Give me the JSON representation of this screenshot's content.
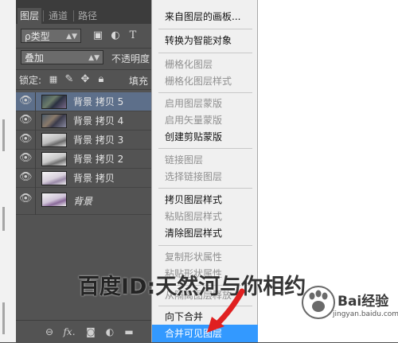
{
  "panel": {
    "tabs": [
      "图层",
      "通道",
      "路径"
    ],
    "filter_kind": "ρ类型",
    "blend_mode": "叠加",
    "opacity_label": "不透明度",
    "lock_label": "锁定:",
    "fill_label": "填充",
    "layers": [
      {
        "name": "背景 拷贝 5",
        "selected": true
      },
      {
        "name": "背景 拷贝 4",
        "selected": false
      },
      {
        "name": "背景 拷贝 3",
        "selected": false
      },
      {
        "name": "背景 拷贝 2",
        "selected": false
      },
      {
        "name": "背景 拷贝",
        "selected": false
      },
      {
        "name": "背景",
        "selected": false
      }
    ],
    "bottom_icons": [
      "link-icon",
      "fx-icon",
      "mask-icon",
      "adjustment-icon",
      "folder-icon"
    ],
    "fx_label": "fx."
  },
  "menu": {
    "items": [
      {
        "label": "来自图层的画板...",
        "enabled": true
      },
      {
        "label": "转换为智能对象",
        "enabled": true
      },
      {
        "label": "栅格化图层",
        "enabled": false
      },
      {
        "label": "栅格化图层样式",
        "enabled": false
      },
      {
        "label": "启用图层蒙版",
        "enabled": false
      },
      {
        "label": "启用矢量蒙版",
        "enabled": false
      },
      {
        "label": "创建剪贴蒙版",
        "enabled": true
      },
      {
        "label": "链接图层",
        "enabled": false
      },
      {
        "label": "选择链接图层",
        "enabled": false
      },
      {
        "label": "拷贝图层样式",
        "enabled": true
      },
      {
        "label": "粘贴图层样式",
        "enabled": false
      },
      {
        "label": "清除图层样式",
        "enabled": true
      },
      {
        "label": "复制形状属性",
        "enabled": false
      },
      {
        "label": "粘贴形状属性",
        "enabled": false
      },
      {
        "label": "从隔离图层释放",
        "enabled": false
      },
      {
        "label": "向下合并",
        "enabled": true
      },
      {
        "label": "合并可见图层",
        "enabled": true,
        "highlighted": true
      }
    ]
  },
  "watermark": "百度ID:天然河与你相约",
  "logo": {
    "text": "Bai经验",
    "url": "jingyan.baidu.com"
  },
  "colors": {
    "highlight": "#3399ff",
    "selected_layer": "#5d6f8a",
    "arrow": "#e02020"
  }
}
